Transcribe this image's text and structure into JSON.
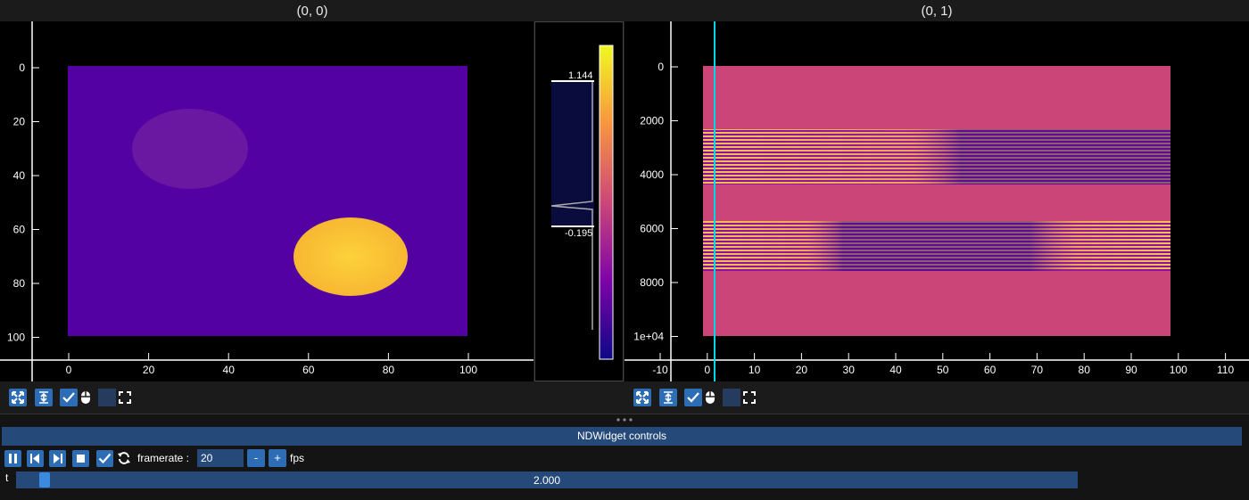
{
  "plots": [
    {
      "title": "(0, 0)",
      "xticks": [
        "0",
        "20",
        "40",
        "60",
        "80",
        "100"
      ],
      "yticks": [
        "0",
        "20",
        "40",
        "60",
        "80",
        "100"
      ]
    },
    {
      "title": "(0, 1)",
      "xticks": [
        "-10",
        "0",
        "10",
        "20",
        "30",
        "40",
        "50",
        "60",
        "70",
        "80",
        "90",
        "100",
        "110"
      ],
      "yticks": [
        "0",
        "2000",
        "4000",
        "6000",
        "8000",
        "1e+04"
      ]
    }
  ],
  "histogram": {
    "max_label": "1.144",
    "min_label": "-0.195",
    "colormap": "plasma"
  },
  "toolbar_icons": [
    "fit-view-icon",
    "center-icon",
    "checkbox-checked-icon",
    "mouse-icon",
    "maximize-icon"
  ],
  "controls": {
    "header": "NDWidget controls",
    "framerate_label": "framerate :",
    "framerate_value": "20",
    "minus_label": "-",
    "plus_label": "+",
    "fps_label": "fps",
    "slider_name": "t",
    "slider_value_text": "2.000",
    "slider_fraction": 0.02
  },
  "colors": {
    "accent": "#2d6db5",
    "header_bg": "#254a7a",
    "cursor_line": "#00d8e8"
  }
}
